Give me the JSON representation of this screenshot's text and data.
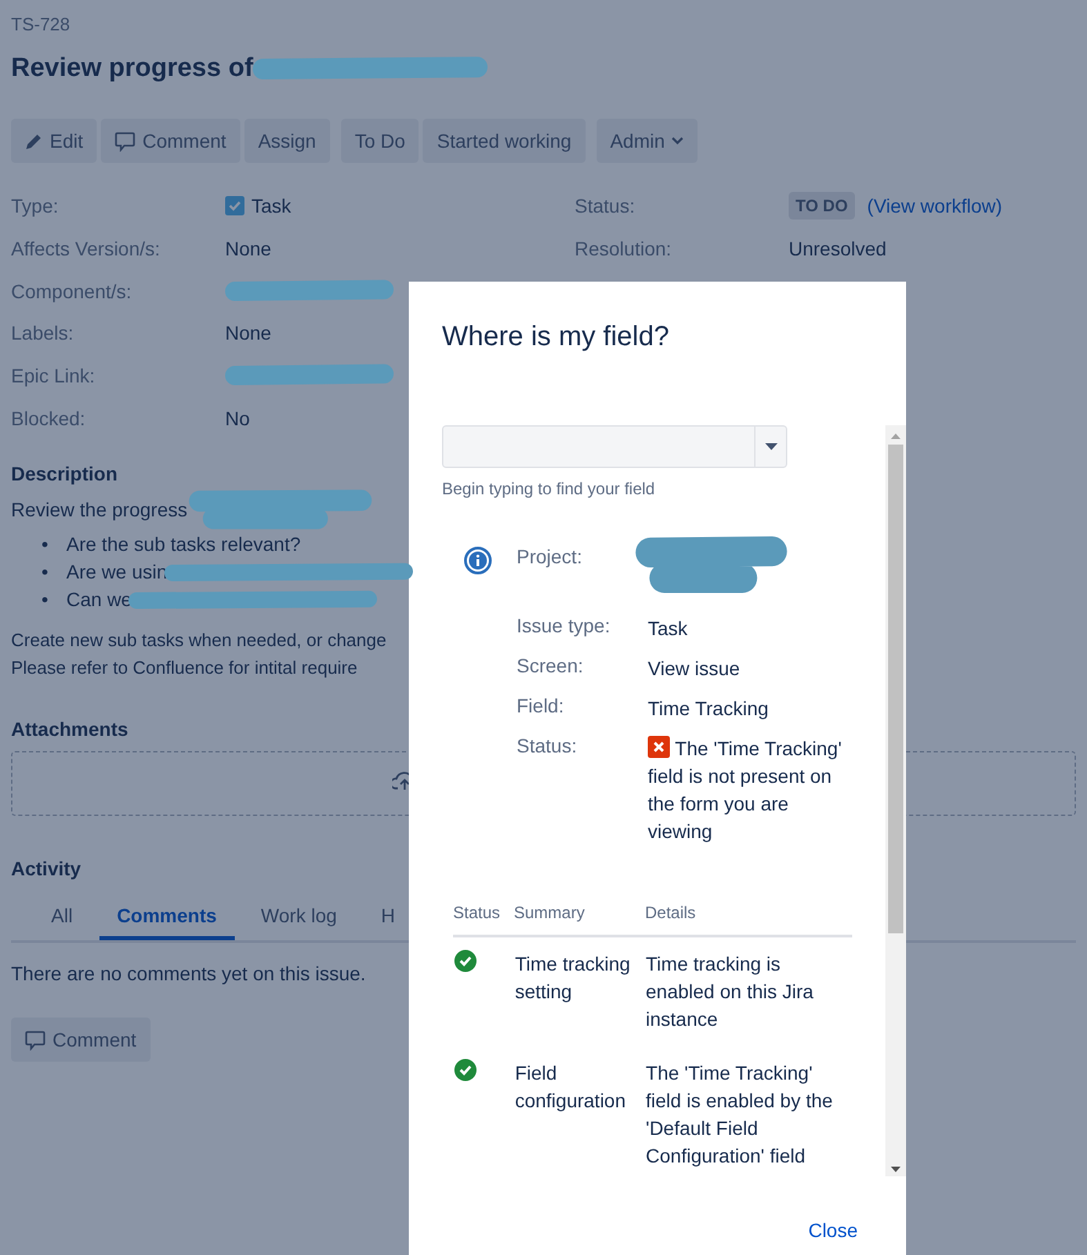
{
  "issue": {
    "key": "TS-728",
    "title": "Review progress of",
    "title_redacted": true
  },
  "toolbar": [
    [
      {
        "label": "Edit",
        "kind": "edit"
      },
      {
        "label": "Comment",
        "kind": "comment"
      },
      {
        "label": "Assign",
        "kind": "plain"
      }
    ],
    [
      {
        "label": "To Do",
        "kind": "plain"
      },
      {
        "label": "Started working",
        "kind": "plain"
      }
    ],
    [
      {
        "label": "Admin",
        "kind": "menu"
      }
    ]
  ],
  "fields_left": [
    {
      "label": "Type:",
      "value": "Task",
      "kind": "issue-type"
    },
    {
      "label": "Affects Version/s:",
      "value": "None"
    },
    {
      "label": "Component/s:",
      "redacted": true
    },
    {
      "label": "Labels:",
      "value": "None"
    },
    {
      "label": "Epic Link:",
      "redacted": true
    },
    {
      "label": "Blocked:",
      "value": "No"
    }
  ],
  "fields_right": [
    {
      "label": "Status:",
      "lozenge": "TO DO",
      "link": "(View workflow)"
    },
    {
      "label": "Resolution:",
      "value": "Unresolved"
    }
  ],
  "description": {
    "heading": "Description",
    "intro": "Review the progress",
    "intro_redacted": true,
    "bullets": [
      {
        "marker": "•",
        "text": "Are the sub tasks relevant?",
        "redacted": false
      },
      {
        "marker": "•",
        "text": "Are we usin",
        "redacted": true
      },
      {
        "marker": "•",
        "text": "Can we",
        "redacted": true
      }
    ],
    "paragraphs": [
      "Create new sub tasks when needed, or change",
      "Please refer to Confluence for intital require"
    ]
  },
  "attachments": {
    "heading": "Attachments"
  },
  "activity": {
    "heading": "Activity",
    "tabs": [
      {
        "label": "All",
        "selected": false
      },
      {
        "label": "Comments",
        "selected": true
      },
      {
        "label": "Work log",
        "selected": false
      },
      {
        "label": "H",
        "selected": false
      }
    ],
    "empty": "There are no comments yet on this issue.",
    "comment_button": "Comment"
  },
  "dialog": {
    "title": "Where is my field?",
    "hint": "Begin typing to find your field",
    "info": [
      {
        "label": "Project:",
        "redacted": true
      },
      {
        "label": "Issue type:",
        "value": "Task"
      },
      {
        "label": "Screen:",
        "value": "View issue"
      },
      {
        "label": "Field:",
        "value": "Time Tracking"
      },
      {
        "label": "Status:",
        "value": "The 'Time Tracking' field is not present on the form you are viewing",
        "kind": "error"
      }
    ],
    "table": {
      "columns": [
        "Status",
        "Summary",
        "Details"
      ],
      "rows": [
        {
          "ok": true,
          "summary": "Time tracking setting",
          "details": "Time tracking is enabled on this Jira instance"
        },
        {
          "ok": true,
          "summary": "Field configuration",
          "details": "The 'Time Tracking' field is enabled by the 'Default Field Configuration' field"
        }
      ]
    },
    "close": "Close"
  }
}
